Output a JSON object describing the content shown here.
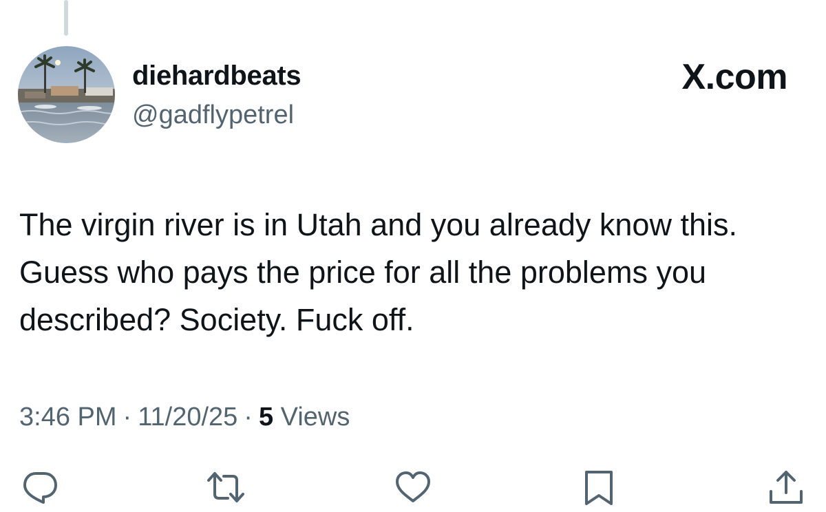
{
  "author": {
    "display_name": "diehardbeats",
    "handle": "@gadflypetrel"
  },
  "brand": "X.com",
  "tweet": {
    "text": "The virgin river is in Utah and you already know this. Guess who pays the price for all the problems you described? Society. Fuck off."
  },
  "meta": {
    "time": "3:46 PM",
    "separator": "·",
    "date": "11/20/25",
    "views_count": "5",
    "views_label": "Views"
  },
  "actions": [
    {
      "icon": "reply-icon"
    },
    {
      "icon": "retweet-icon"
    },
    {
      "icon": "like-icon"
    },
    {
      "icon": "bookmark-icon"
    },
    {
      "icon": "share-icon"
    }
  ],
  "colors": {
    "text_primary": "#0f1419",
    "text_secondary": "#536471",
    "icon": "#536471"
  }
}
